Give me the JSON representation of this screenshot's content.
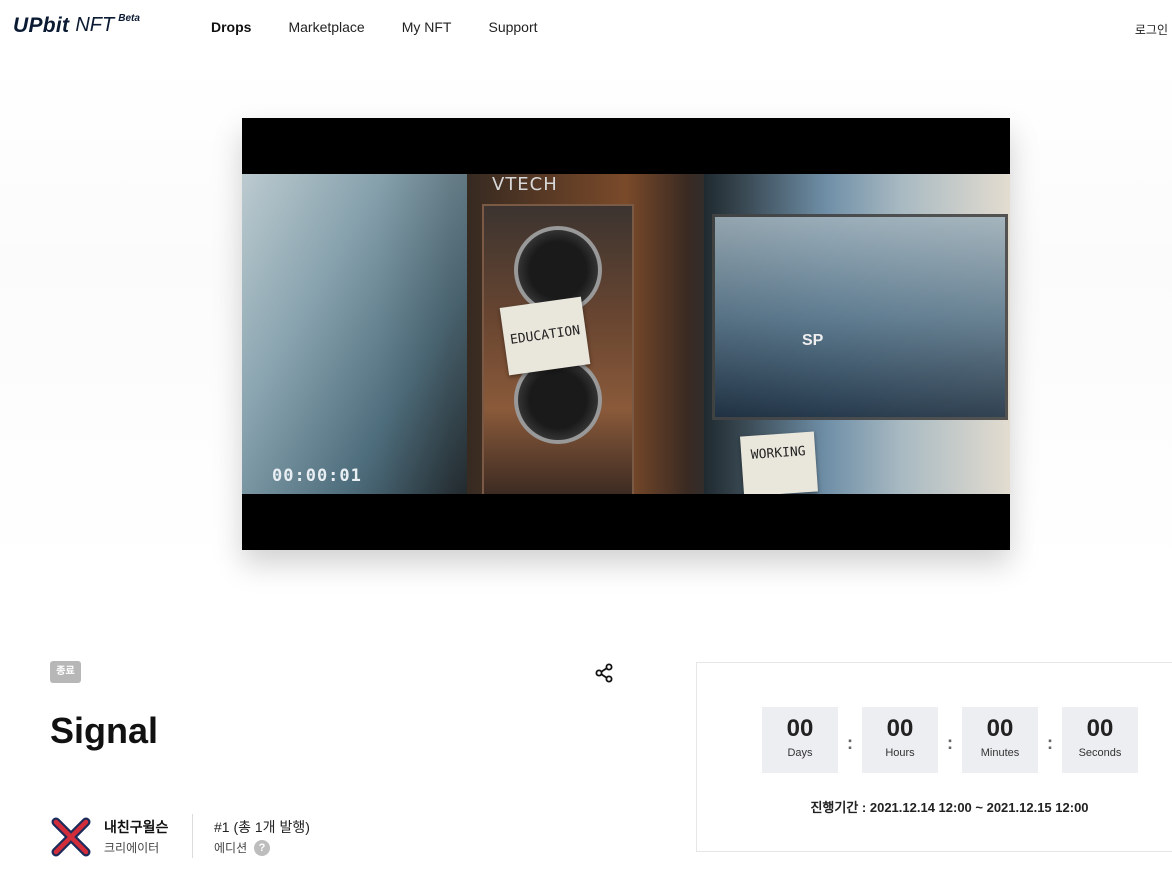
{
  "header": {
    "logo_text": "UPbit",
    "logo_sub": "NFT",
    "logo_beta": "Beta",
    "nav": [
      "Drops",
      "Marketplace",
      "My NFT",
      "Support"
    ],
    "login": "로그인"
  },
  "video": {
    "brand": "VTECH",
    "note1": "EDUCATION",
    "note2": "WORKING",
    "overlay_text": "SP",
    "timecode": "00:00:01"
  },
  "item": {
    "status_badge": "종료",
    "title": "Signal",
    "creator_name": "내친구윌슨",
    "creator_role": "크리에이터",
    "edition_value": "#1 (총 1개 발행)",
    "edition_label": "에디션",
    "help": "?"
  },
  "countdown": {
    "days": "00",
    "days_label": "Days",
    "hours": "00",
    "hours_label": "Hours",
    "minutes": "00",
    "minutes_label": "Minutes",
    "seconds": "00",
    "seconds_label": "Seconds",
    "separator": ":",
    "period": "진행기간 : 2021.12.14 12:00 ~ 2021.12.15 12:00"
  },
  "icons": {
    "share": "share-icon",
    "avatar": "creator-x-logo"
  },
  "colors": {
    "badge_bg": "#b7b7b7",
    "count_box_bg": "#edeef2",
    "avatar_red": "#d32d3a",
    "avatar_navy": "#1d2b5a"
  }
}
